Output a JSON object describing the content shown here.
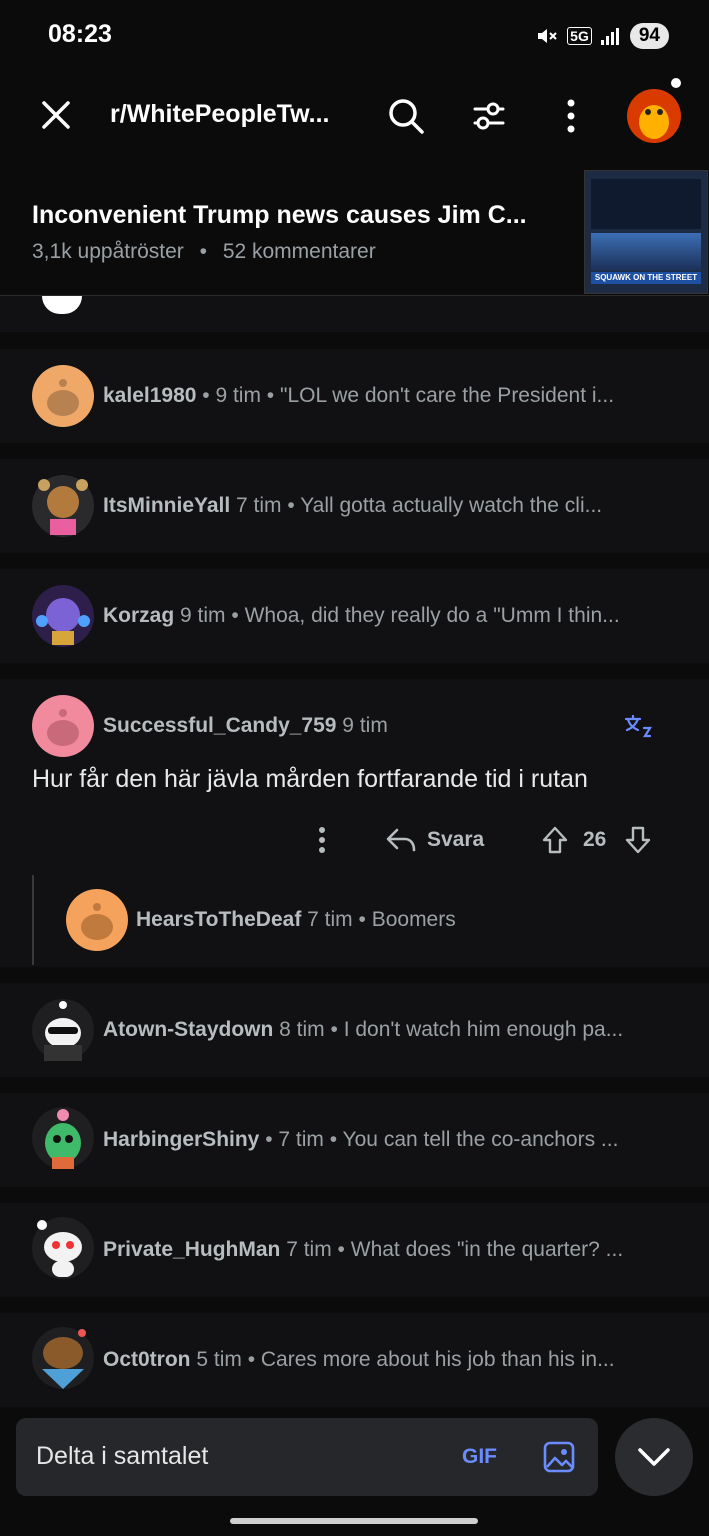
{
  "status": {
    "time": "08:23",
    "battery": "94",
    "network": "5G"
  },
  "header": {
    "subreddit": "r/WhitePeopleTw..."
  },
  "post": {
    "title": "Inconvenient Trump news causes Jim C...",
    "upvotes": "3,1k uppåtröster",
    "separator": "•",
    "comments": "52 kommentarer",
    "thumbnail_caption": "SQUAWK ON THE STREET"
  },
  "comments": [
    {
      "user": "kalel1980",
      "meta": " • 9 tim • ",
      "preview": "\"LOL we don't care the President i...",
      "avatar_color": "#f0a868"
    },
    {
      "user": "ItsMinnieYall",
      "meta": " 7 tim • ",
      "preview": "Yall gotta actually watch the cli...",
      "avatar_color": "#c8894a"
    },
    {
      "user": "Korzag",
      "meta": " 9 tim • ",
      "preview": "Whoa, did they really do a \"Umm I thin...",
      "avatar_color": "#6a4fb8"
    },
    {
      "user": "Atown-Staydown",
      "meta": " 8 tim • ",
      "preview": "I don't watch him enough pa...",
      "avatar_color": "#2b2b2b"
    },
    {
      "user": "HarbingerShiny",
      "meta": " • 7 tim • ",
      "preview": "You can tell the co-anchors ...",
      "avatar_color": "#3fb96a"
    },
    {
      "user": "Private_HughMan",
      "meta": " 7 tim • ",
      "preview": "What does \"in the quarter? ...",
      "avatar_color": "#f2f2f2"
    },
    {
      "user": "Oct0tron",
      "meta": " 5 tim • ",
      "preview": "Cares more about his job than his in...",
      "avatar_color": "#8a5a2b"
    }
  ],
  "expanded": {
    "user": "Successful_Candy_759",
    "time": " 9 tim",
    "body": "Hur får den här jävla mården fortfarande tid i rutan",
    "reply_label": "Svara",
    "score": "26",
    "avatar_color": "#f08a9c",
    "reply": {
      "user": "HearsToTheDeaf",
      "meta": " 7 tim • ",
      "preview": "Boomers",
      "avatar_color": "#f5a25d"
    }
  },
  "composer": {
    "placeholder": "Delta i samtalet",
    "gif_label": "GIF"
  },
  "colors": {
    "accent": "#6b8cff",
    "background": "#0b0b0c",
    "card": "#111113"
  }
}
